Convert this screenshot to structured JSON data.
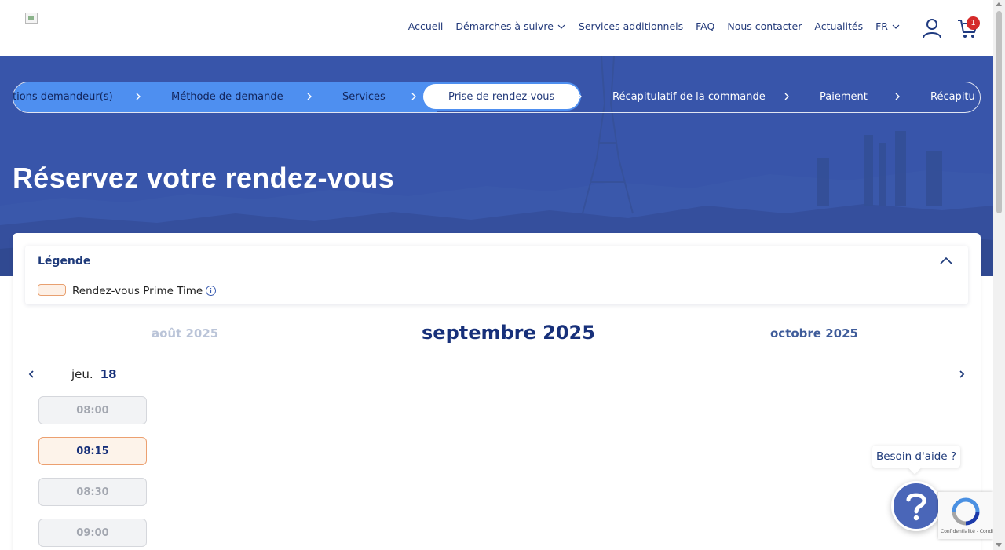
{
  "nav": {
    "items": [
      "Accueil",
      "Démarches à suivre",
      "Services additionnels",
      "FAQ",
      "Nous contacter",
      "Actualités"
    ],
    "language": "FR",
    "cart_count": "1"
  },
  "stepper": {
    "steps": [
      "tions demandeur(s)",
      "Méthode de demande",
      "Services",
      "Prise de rendez-vous",
      "Récapitulatif de la commande",
      "Paiement",
      "Récapitul"
    ],
    "active_index": 3
  },
  "page": {
    "title": "Réservez votre rendez-vous"
  },
  "legend": {
    "title": "Légende",
    "prime_label": "Rendez-vous Prime Time"
  },
  "calendar": {
    "prev_month": "août 2025",
    "current_month": "septembre 2025",
    "next_month": "octobre 2025",
    "day_name": "jeu.",
    "day_number": "18",
    "slots": [
      {
        "time": "08:00",
        "type": "standard"
      },
      {
        "time": "08:15",
        "type": "prime"
      },
      {
        "time": "08:30",
        "type": "standard"
      },
      {
        "time": "09:00",
        "type": "standard"
      }
    ]
  },
  "help": {
    "label": "Besoin d'aide ?"
  },
  "recaptcha": {
    "text": "Confidentialité - Conditions"
  },
  "colors": {
    "primary": "#17307a",
    "stepper_done": "#4e8ff0",
    "prime_border": "#eca070",
    "badge": "#d52a2a"
  }
}
